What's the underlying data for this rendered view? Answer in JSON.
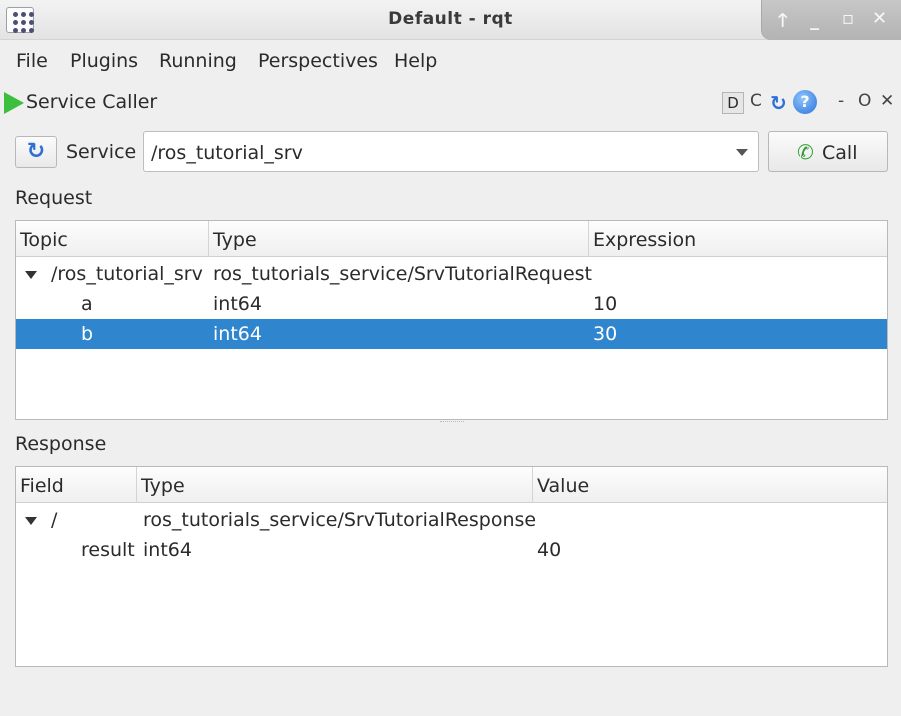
{
  "window": {
    "title": "Default - rqt"
  },
  "menu": [
    "File",
    "Plugins",
    "Running",
    "Perspectives",
    "Help"
  ],
  "plugin": {
    "title": "Service Caller",
    "header_buttons": {
      "d": "D",
      "c": "C",
      "help": "?",
      "minimize": "-",
      "float": "O",
      "close": "✕"
    }
  },
  "service": {
    "label": "Service",
    "selected": "/ros_tutorial_srv",
    "call_label": "Call"
  },
  "request": {
    "label": "Request",
    "columns": [
      "Topic",
      "Type",
      "Expression"
    ],
    "rows": [
      {
        "topic": "/ros_tutorial_srv",
        "type": "ros_tutorials_service/SrvTutorialRequest",
        "expression": "",
        "expanded": true
      },
      {
        "topic": "a",
        "type": "int64",
        "expression": "10"
      },
      {
        "topic": "b",
        "type": "int64",
        "expression": "30",
        "selected": true
      }
    ]
  },
  "response": {
    "label": "Response",
    "columns": [
      "Field",
      "Type",
      "Value"
    ],
    "rows": [
      {
        "field": "/",
        "type": "ros_tutorials_service/SrvTutorialResponse",
        "value": "",
        "expanded": true
      },
      {
        "field": "result",
        "type": "int64",
        "value": "40"
      }
    ]
  },
  "colors": {
    "selection": "#2f86cf",
    "play": "#3cbf3c",
    "accent": "#2f6fd6"
  }
}
